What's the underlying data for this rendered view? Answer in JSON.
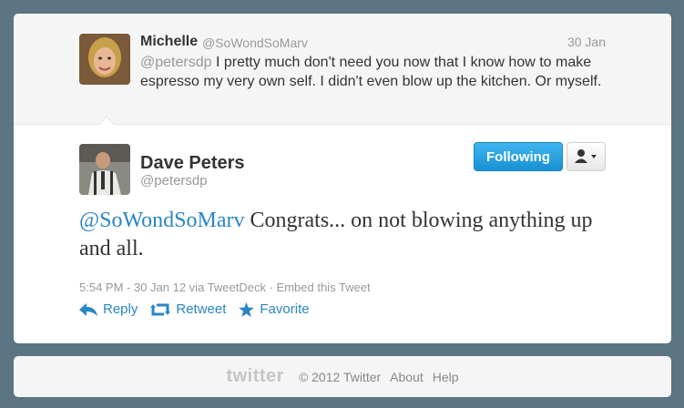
{
  "context_tweet": {
    "name": "Michelle",
    "handle": "@SoWondSoMarv",
    "date": "30 Jan",
    "mention": "@petersdp",
    "text": " I pretty much don't need you now that I know how to make espresso my very own self. I didn't even blow up the kitchen. Or myself."
  },
  "main_tweet": {
    "name": "Dave Peters",
    "handle": "@petersdp",
    "follow_label": "Following",
    "mention": "@SoWondSoMarv",
    "text": " Congrats... on not blowing anything up and all.",
    "meta": "5:54 PM - 30 Jan 12 via TweetDeck · Embed this Tweet",
    "actions": {
      "reply": "Reply",
      "retweet": "Retweet",
      "favorite": "Favorite"
    }
  },
  "footer": {
    "logo": "twitter",
    "copyright": "© 2012 Twitter",
    "about": "About",
    "help": "Help"
  },
  "colors": {
    "background": "#5b7584",
    "link": "#2a86c4",
    "follow_button": "#1891d2"
  }
}
